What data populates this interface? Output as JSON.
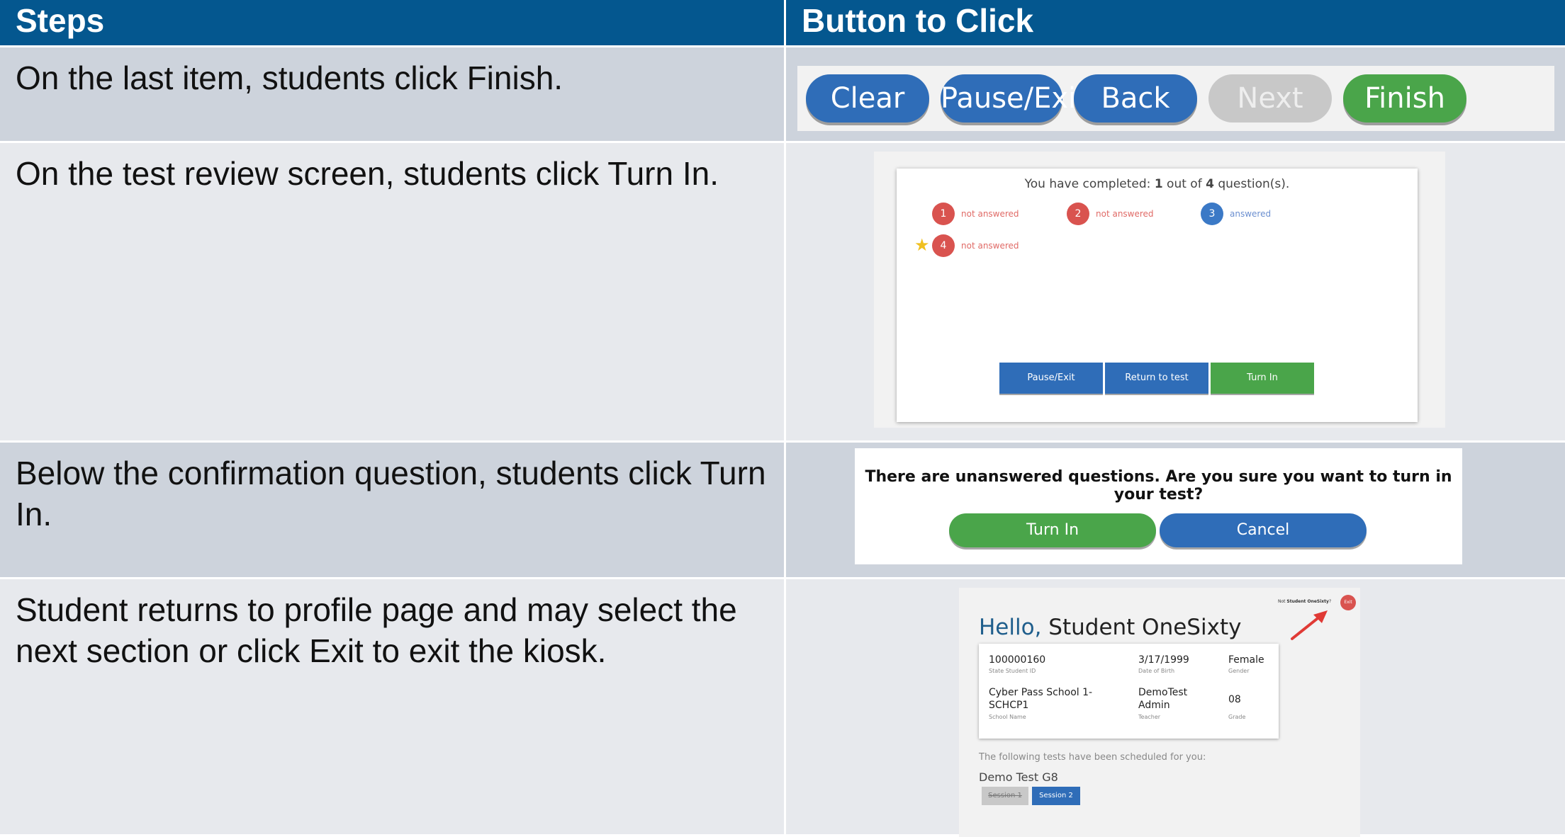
{
  "header": {
    "steps_label": "Steps",
    "button_label": "Button to Click"
  },
  "rows": [
    {
      "step": "On the last item, students click Finish."
    },
    {
      "step": "On the test review screen, students click Turn In."
    },
    {
      "step": "Below the confirmation question, students click Turn In."
    },
    {
      "step": "Student returns to profile page and may select the next section or click Exit to exit the kiosk."
    }
  ],
  "toolbar": {
    "clear": "Clear",
    "pause_exit": "Pause/Exit",
    "back": "Back",
    "next": "Next",
    "finish": "Finish"
  },
  "review": {
    "completed_prefix": "You have completed: ",
    "completed_count": "1",
    "completed_mid": " out of ",
    "total_count": "4",
    "completed_suffix": " question(s).",
    "questions": [
      {
        "num": "1",
        "status": "not answered"
      },
      {
        "num": "2",
        "status": "not answered"
      },
      {
        "num": "3",
        "status": "answered"
      },
      {
        "num": "4",
        "status": "not answered"
      }
    ],
    "pause_exit": "Pause/Exit",
    "return_to_test": "Return to test",
    "turn_in": "Turn In"
  },
  "confirm": {
    "question": "There are unanswered questions. Are you sure you want to turn in your test?",
    "turn_in": "Turn In",
    "cancel": "Cancel"
  },
  "profile": {
    "not_prefix": "Not ",
    "not_name": "Student OneSixty",
    "not_suffix": "?",
    "exit": "Exit",
    "hello": "Hello,",
    "student_name": "Student OneSixty",
    "state_id": "100000160",
    "state_id_label": "State Student ID",
    "dob": "3/17/1999",
    "dob_label": "Date of Birth",
    "gender": "Female",
    "gender_label": "Gender",
    "school_line1": "Cyber Pass School 1-",
    "school_line2": "SCHCP1",
    "school_label": "School Name",
    "teacher_line1": "DemoTest",
    "teacher_line2": "Admin",
    "teacher_label": "Teacher",
    "grade": "08",
    "grade_label": "Grade",
    "scheduled": "The following tests have been scheduled for you:",
    "test_name": "Demo Test G8",
    "session1": "Session 1",
    "session2": "Session 2"
  },
  "colors": {
    "header_bg": "#04578f",
    "blue_button": "#2f6db8",
    "green_button": "#4aa54a",
    "red_status": "#d9534f"
  }
}
